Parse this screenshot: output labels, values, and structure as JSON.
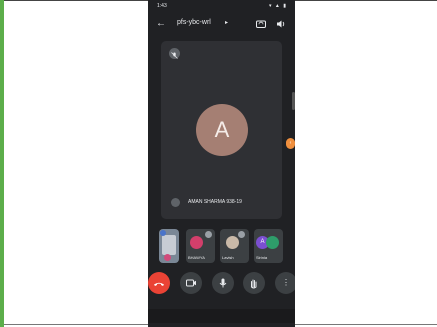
{
  "status_bar": {
    "time": "1:43",
    "icons": "▾ ▲ ▮"
  },
  "top_bar": {
    "meeting_code": "pfs-ybc-wrl",
    "caret": "▸"
  },
  "main_tile": {
    "avatar_letter": "A",
    "participant_name": "AMAN SHARMA 938-19"
  },
  "strip": {
    "tiles": [
      {
        "label": "BHAWYA",
        "initial": "",
        "color": "#d23f6b"
      },
      {
        "label": "Lavish",
        "initial": "",
        "color": "#c9b9a8"
      },
      {
        "label": "Sirinia",
        "initial": "A",
        "color": "#7b4fd1"
      }
    ]
  },
  "edge_handle": {
    "glyph": "‹"
  },
  "controls": {
    "end": "📞",
    "video": "▮",
    "mic": "🎙",
    "hand": "✋",
    "more": "⋮"
  },
  "colors": {
    "end_call": "#ea4335",
    "avatar": "#a57f73",
    "background": "#202124"
  }
}
